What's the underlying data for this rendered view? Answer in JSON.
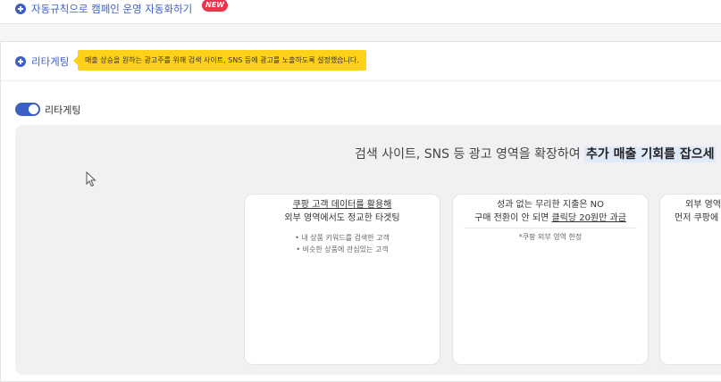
{
  "top_section": {
    "link_label": "자동규칙으로 캠페인 운영 자동화하기",
    "badge": "NEW"
  },
  "retargeting_section": {
    "link_label": "리타게팅",
    "tooltip": "매출 상승을 원하는 광고주를 위해 검색 사이트, SNS 등에 광고를 노출하도록 설정했습니다.",
    "toggle_label": "리타게팅",
    "toggle_on": true
  },
  "promo": {
    "headline_prefix": "검색 사이트, SNS 등 광고 영역을 확장하여 ",
    "headline_highlight": "추가 매출 기회를 잡으세",
    "cards": [
      {
        "line1": "쿠팡 고객 데이터를 활용해",
        "line2": "외부 영역에서도 정교한 타겟팅",
        "bullets": [
          "• 내 상품 키워드를 검색한 고객",
          "• 비슷한 상품에 관심있는 고객"
        ]
      },
      {
        "line1": "성과 없는 무리한 지출은 NO",
        "line2_prefix": "구매 전환이 안 되면 ",
        "line2_underlined": "클릭당 20원만 과금",
        "note": "*쿠팡 외부 영역 한정"
      },
      {
        "line1": "외부 영역",
        "line2": "먼저 쿠팡에"
      }
    ]
  },
  "colors": {
    "accent": "#3c5fc5",
    "tooltip_bg": "#ffd119",
    "badge_bg": "#e8374c"
  }
}
